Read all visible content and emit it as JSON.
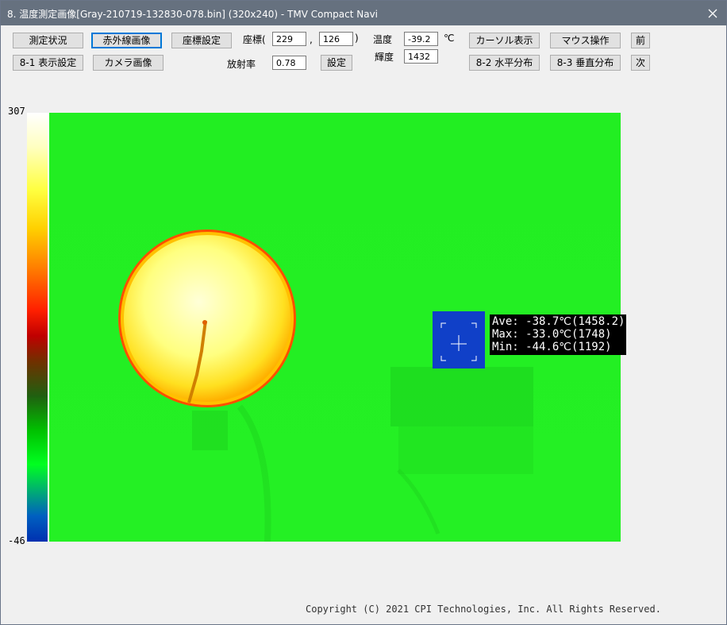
{
  "window": {
    "title": "8. 温度測定画像[Gray-210719-132830-078.bin] (320x240) - TMV Compact Navi"
  },
  "toolbar": {
    "measure_status": "測定状況",
    "infrared_image": "赤外線画像",
    "coord_settings": "座標設定",
    "display_settings": "8-1 表示設定",
    "camera_image": "カメラ画像",
    "cursor_display": "カーソル表示",
    "mouse_operation": "マウス操作",
    "prev": "前",
    "horizontal_dist": "8-2 水平分布",
    "vertical_dist": "8-3 垂直分布",
    "next": "次",
    "set": "設定"
  },
  "coords": {
    "label": "座標(",
    "x": "229",
    "sep": ",",
    "y": "126",
    "close": ")"
  },
  "emissivity": {
    "label": "放射率",
    "value": "0.78"
  },
  "temperature": {
    "label": "温度",
    "value": "-39.2",
    "unit": "℃"
  },
  "brightness": {
    "label": "輝度",
    "value": "1432"
  },
  "scale": {
    "max": "307",
    "min": "-46"
  },
  "readout": {
    "ave": "Ave: -38.7℃(1458.2)",
    "max": "Max: -33.0℃(1748)",
    "min": "Min: -44.6℃(1192)"
  },
  "footer": {
    "copyright": "Copyright (C) 2021 CPI Technologies, Inc. All Rights Reserved."
  }
}
